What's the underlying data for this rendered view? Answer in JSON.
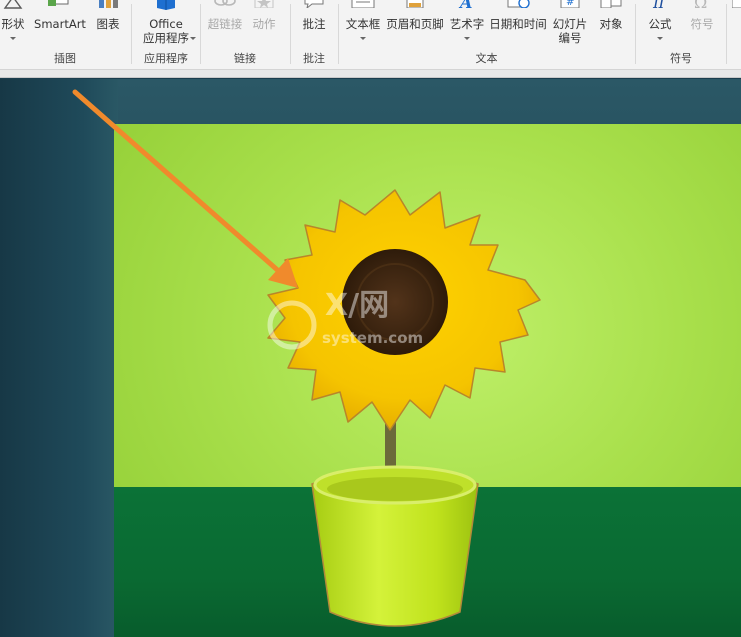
{
  "ribbon": {
    "groups": {
      "illustrations": {
        "label": "插图",
        "buttons": {
          "shapes": "形状",
          "smartart": "SmartArt",
          "chart": "图表"
        }
      },
      "apps": {
        "label": "应用程序",
        "buttons": {
          "office_line1": "Office",
          "office_line2": "应用程序"
        }
      },
      "links": {
        "label": "链接",
        "buttons": {
          "hyperlink": "超链接",
          "action": "动作"
        }
      },
      "comments": {
        "label": "批注",
        "buttons": {
          "comment": "批注"
        }
      },
      "text": {
        "label": "文本",
        "buttons": {
          "textbox": "文本框",
          "header_footer": "页眉和页脚",
          "wordart": "艺术字",
          "datetime": "日期和时间",
          "slide_number_line1": "幻灯片",
          "slide_number_line2": "编号",
          "object": "对象"
        }
      },
      "symbols": {
        "label": "符号",
        "buttons": {
          "equation": "公式",
          "symbol": "符号"
        }
      }
    }
  },
  "watermark": {
    "text": "X/网",
    "subtext": "system.com"
  },
  "colors": {
    "accent_blue": "#1e6fd0",
    "arrow_orange": "#f08a2c",
    "background_green": "#a9e04c",
    "ground_green": "#0a6a32",
    "pot_yellow": "#c8e81e",
    "petal_yellow": "#f5c400",
    "flower_center": "#3b2410"
  }
}
